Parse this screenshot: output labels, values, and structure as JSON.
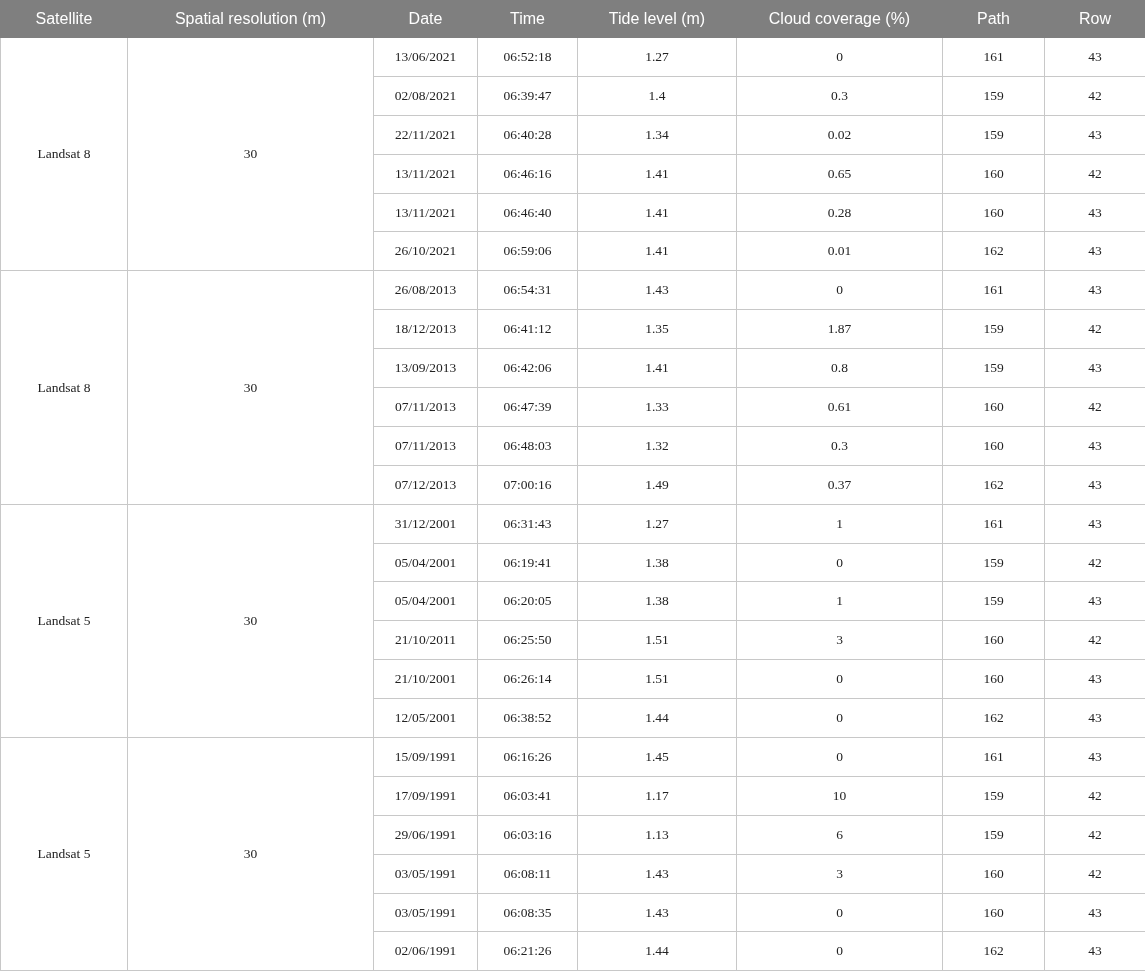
{
  "table": {
    "columns": [
      "Satellite",
      "Spatial resolution (m)",
      "Date",
      "Time",
      "Tide level (m)",
      "Cloud coverage (%)",
      "Path",
      "Row"
    ],
    "groups": [
      {
        "satellite": "Landsat 8",
        "resolution": "30",
        "rows": [
          [
            "13/06/2021",
            "06:52:18",
            "1.27",
            "0",
            "161",
            "43"
          ],
          [
            "02/08/2021",
            "06:39:47",
            "1.4",
            "0.3",
            "159",
            "42"
          ],
          [
            "22/11/2021",
            "06:40:28",
            "1.34",
            "0.02",
            "159",
            "43"
          ],
          [
            "13/11/2021",
            "06:46:16",
            "1.41",
            "0.65",
            "160",
            "42"
          ],
          [
            "13/11/2021",
            "06:46:40",
            "1.41",
            "0.28",
            "160",
            "43"
          ],
          [
            "26/10/2021",
            "06:59:06",
            "1.41",
            "0.01",
            "162",
            "43"
          ]
        ]
      },
      {
        "satellite": "Landsat 8",
        "resolution": "30",
        "rows": [
          [
            "26/08/2013",
            "06:54:31",
            "1.43",
            "0",
            "161",
            "43"
          ],
          [
            "18/12/2013",
            "06:41:12",
            "1.35",
            "1.87",
            "159",
            "42"
          ],
          [
            "13/09/2013",
            "06:42:06",
            "1.41",
            "0.8",
            "159",
            "43"
          ],
          [
            "07/11/2013",
            "06:47:39",
            "1.33",
            "0.61",
            "160",
            "42"
          ],
          [
            "07/11/2013",
            "06:48:03",
            "1.32",
            "0.3",
            "160",
            "43"
          ],
          [
            "07/12/2013",
            "07:00:16",
            "1.49",
            "0.37",
            "162",
            "43"
          ]
        ]
      },
      {
        "satellite": "Landsat 5",
        "resolution": "30",
        "rows": [
          [
            "31/12/2001",
            "06:31:43",
            "1.27",
            "1",
            "161",
            "43"
          ],
          [
            "05/04/2001",
            "06:19:41",
            "1.38",
            "0",
            "159",
            "42"
          ],
          [
            "05/04/2001",
            "06:20:05",
            "1.38",
            "1",
            "159",
            "43"
          ],
          [
            "21/10/2011",
            "06:25:50",
            "1.51",
            "3",
            "160",
            "42"
          ],
          [
            "21/10/2001",
            "06:26:14",
            "1.51",
            "0",
            "160",
            "43"
          ],
          [
            "12/05/2001",
            "06:38:52",
            "1.44",
            "0",
            "162",
            "43"
          ]
        ]
      },
      {
        "satellite": "Landsat 5",
        "resolution": "30",
        "rows": [
          [
            "15/09/1991",
            "06:16:26",
            "1.45",
            "0",
            "161",
            "43"
          ],
          [
            "17/09/1991",
            "06:03:41",
            "1.17",
            "10",
            "159",
            "42"
          ],
          [
            "29/06/1991",
            "06:03:16",
            "1.13",
            "6",
            "159",
            "42"
          ],
          [
            "03/05/1991",
            "06:08:11",
            "1.43",
            "3",
            "160",
            "42"
          ],
          [
            "03/05/1991",
            "06:08:35",
            "1.43",
            "0",
            "160",
            "43"
          ],
          [
            "02/06/1991",
            "06:21:26",
            "1.44",
            "0",
            "162",
            "43"
          ]
        ]
      }
    ]
  }
}
